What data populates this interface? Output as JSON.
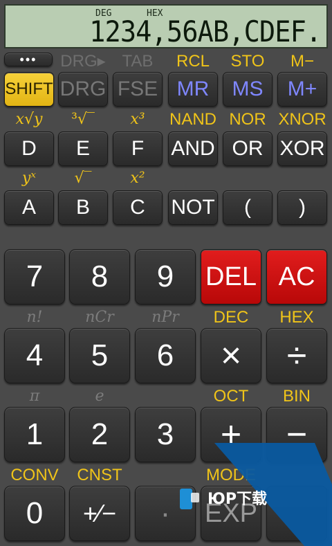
{
  "display": {
    "angle_mode": "DEG",
    "number_mode": "HEX",
    "value": "1234,56AB,CDEF."
  },
  "labels": {
    "drg_arrow": "DRG▸",
    "tab": "TAB",
    "rcl": "RCL",
    "sto": "STO",
    "mminus": "M−",
    "xroot_y": "x√y",
    "cube_root": "³√‾",
    "x_cubed": "x³",
    "nand": "NAND",
    "nor": "NOR",
    "xnor": "XNOR",
    "y_pow_x": "yˣ",
    "sqrt": "√‾",
    "x_squared": "x²",
    "n_fact": "n!",
    "ncr": "nCr",
    "npr": "nPr",
    "dec": "DEC",
    "hex": "HEX",
    "pi": "π",
    "e": "e",
    "oct": "OCT",
    "bin": "BIN",
    "conv": "CONV",
    "cnst": "CNST",
    "mode": "MODE"
  },
  "keys": {
    "menu": "•••",
    "shift": "SHIFT",
    "drg": "DRG",
    "fse": "FSE",
    "mr": "MR",
    "ms": "MS",
    "mplus": "M+",
    "d": "D",
    "e": "E",
    "f": "F",
    "and": "AND",
    "or": "OR",
    "xor": "XOR",
    "a": "A",
    "b": "B",
    "c": "C",
    "not": "NOT",
    "lparen": "(",
    "rparen": ")",
    "n7": "7",
    "n8": "8",
    "n9": "9",
    "del": "DEL",
    "ac": "AC",
    "n4": "4",
    "n5": "5",
    "n6": "6",
    "mul": "×",
    "div": "÷",
    "n1": "1",
    "n2": "2",
    "n3": "3",
    "plus": "+",
    "minus": "−",
    "n0": "0",
    "plusminus": "+∕−",
    "dot": "·",
    "exp": "EXP"
  },
  "watermark": {
    "text": "ЮР下载"
  },
  "colors": {
    "accent_yellow": "#f0c419",
    "memory_blue": "#7f87ff",
    "danger_red": "#d41010",
    "watermark_blue": "#0a5aa0"
  }
}
